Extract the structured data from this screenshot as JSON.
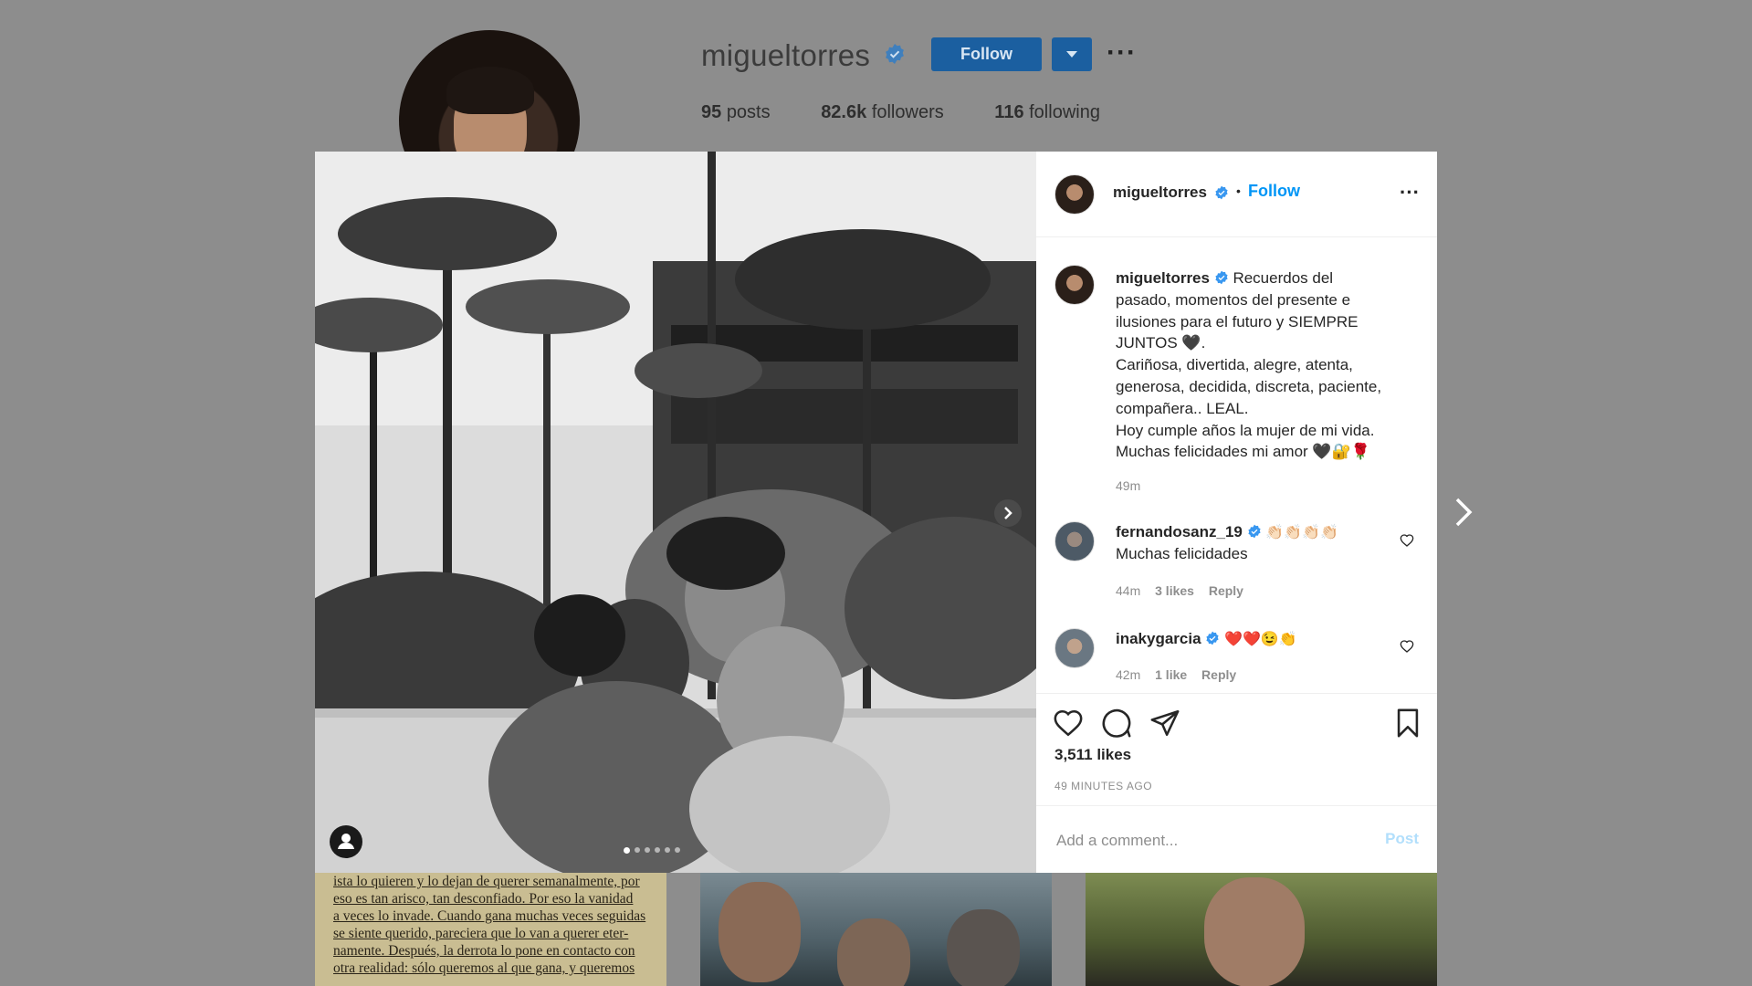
{
  "profile": {
    "username": "migueltorres",
    "follow_label": "Follow",
    "more_label": "···",
    "stats": [
      {
        "count": "95",
        "label": "posts"
      },
      {
        "count": "82.6k",
        "label": "followers"
      },
      {
        "count": "116",
        "label": "following"
      }
    ]
  },
  "post": {
    "username": "migueltorres",
    "follow_label": "Follow",
    "dot": "•",
    "more_label": "···",
    "caption_lines": [
      "Recuerdos del",
      "pasado, momentos del presente e",
      "ilusiones para el futuro y SIEMPRE",
      "JUNTOS 🖤.",
      "Cariñosa, divertida, alegre, atenta,",
      "generosa, decidida, discreta, paciente,",
      "compañera.. LEAL.",
      "Hoy cumple años la mujer de mi vida.",
      "Muchas felicidades mi amor 🖤🔐🌹"
    ],
    "caption_time": "49m",
    "comments": [
      {
        "username": "fernandosanz_19",
        "text_inline": "👏🏻👏🏻👏🏻👏🏻",
        "text_line2": "Muchas felicidades",
        "time": "44m",
        "likes": "3 likes",
        "reply": "Reply"
      },
      {
        "username": "inakygarcia",
        "text_inline": "❤️❤️😉👏",
        "text_line2": "",
        "time": "42m",
        "likes": "1 like",
        "reply": "Reply"
      }
    ],
    "likes_count": "3,511 likes",
    "time_ago": "49 MINUTES AGO",
    "comment_placeholder": "Add a comment...",
    "post_label": "Post"
  },
  "grid_thumb_text": [
    "ista lo quieren y lo dejan de querer semanalmente, por",
    "eso es tan arisco, tan desconfiado. Por eso la vanidad",
    "a veces lo invade. Cuando gana muchas veces seguidas",
    "se siente querido, pareciera que lo van a querer eter-",
    "namente. Después, la derrota lo pone en contacto con",
    "otra realidad: sólo queremos al que gana, y queremos"
  ],
  "colors": {
    "verified": "#3897f0",
    "link": "#0095f6",
    "follow_button": "#1b5fa0",
    "overlay": "#8d8d8d"
  },
  "icons": [
    "verified-badge-icon",
    "heart-icon",
    "comment-icon",
    "share-icon",
    "bookmark-icon",
    "chevron-right-icon",
    "user-tag-icon",
    "more-icon"
  ]
}
